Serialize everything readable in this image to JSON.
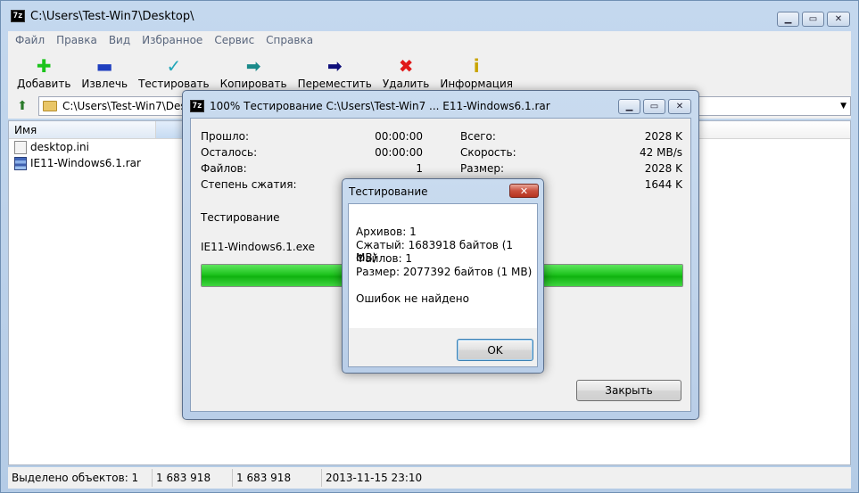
{
  "window": {
    "title": "C:\\Users\\Test-Win7\\Desktop\\",
    "app_icon": "7z"
  },
  "menu": [
    "Файл",
    "Правка",
    "Вид",
    "Избранное",
    "Сервис",
    "Справка"
  ],
  "toolbar": [
    {
      "label": "Добавить",
      "icon": "plus-icon",
      "glyph": "✚",
      "color": "#1cc41c"
    },
    {
      "label": "Извлечь",
      "icon": "minus-icon",
      "glyph": "▬",
      "color": "#1f3fbf"
    },
    {
      "label": "Тестировать",
      "icon": "check-icon",
      "glyph": "✓",
      "color": "#22a6b8"
    },
    {
      "label": "Копировать",
      "icon": "copy-arrow-icon",
      "glyph": "➡",
      "color": "#1a8a8a"
    },
    {
      "label": "Переместить",
      "icon": "move-arrow-icon",
      "glyph": "➡",
      "color": "#0e0e7a"
    },
    {
      "label": "Удалить",
      "icon": "delete-icon",
      "glyph": "✖",
      "color": "#e01818"
    },
    {
      "label": "Информация",
      "icon": "info-icon",
      "glyph": "i",
      "color": "#c9a400"
    }
  ],
  "address": {
    "path": "C:\\Users\\Test-Win7\\Deskt"
  },
  "filelist": {
    "column_name": "Имя",
    "files": [
      {
        "name": "desktop.ini",
        "type": "ini"
      },
      {
        "name": "IE11-Windows6.1.rar",
        "type": "rar"
      }
    ]
  },
  "statusbar": {
    "selected": "Выделено объектов: 1",
    "size": "1 683 918",
    "packed": "1 683 918",
    "modified": "2013-11-15 23:10"
  },
  "progress_dialog": {
    "title": "100% Тестирование C:\\Users\\Test-Win7 ... E11-Windows6.1.rar",
    "elapsed_label": "Прошло:",
    "elapsed": "00:00:00",
    "remaining_label": "Осталось:",
    "remaining": "00:00:00",
    "files_label": "Файлов:",
    "files": "1",
    "ratio_label": "Степень сжатия:",
    "total_label": "Всего:",
    "total": "2028 K",
    "speed_label": "Скорость:",
    "speed": "42 MB/s",
    "size_label": "Размер:",
    "size": "2028 K",
    "packed": "1644 K",
    "operation": "Тестирование",
    "current_file": "IE11-Windows6.1.exe",
    "progress": 1.0,
    "close_label": "Закрыть"
  },
  "message_box": {
    "title": "Тестирование",
    "archives": "Архивов: 1",
    "packed": "Сжатый: 1683918 байтов (1 MB)",
    "files": "Файлов: 1",
    "size": "Размер: 2077392 байтов (1 MB)",
    "result": "Ошибок не найдено",
    "ok_label": "OK"
  }
}
